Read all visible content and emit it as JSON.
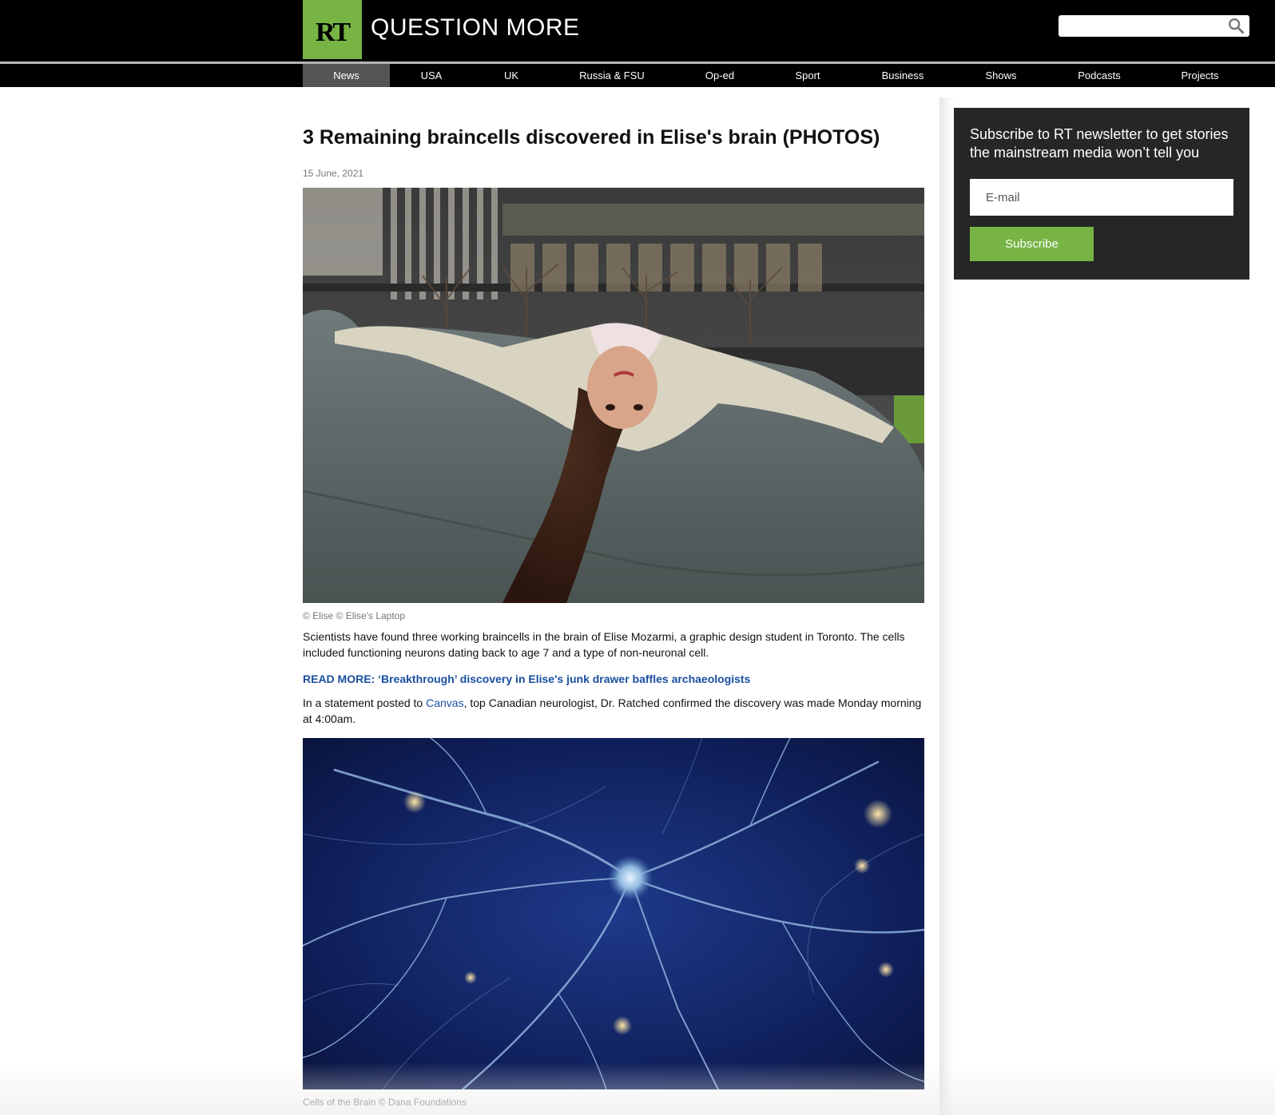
{
  "header": {
    "logo_text": "RT",
    "tagline": "QUESTION MORE",
    "search_placeholder": ""
  },
  "nav": {
    "items": [
      {
        "label": "News",
        "active": true
      },
      {
        "label": "USA"
      },
      {
        "label": "UK"
      },
      {
        "label": "Russia & FSU"
      },
      {
        "label": "Op-ed"
      },
      {
        "label": "Sport"
      },
      {
        "label": "Business"
      },
      {
        "label": "Shows"
      },
      {
        "label": "Podcasts"
      },
      {
        "label": "Projects"
      }
    ]
  },
  "article": {
    "title": "3 Remaining braincells discovered in Elise's brain (PHOTOS)",
    "date": "15 June, 2021",
    "image1_caption": "© Elise © Elise's Laptop",
    "paragraph1": "Scientists have found three working braincells in the brain of Elise Mozarmi, a graphic design student in Toronto. The cells included functioning neurons dating back to age 7 and a type of non-neuronal cell.",
    "read_more": "READ MORE: ‘Breakthrough’ discovery in Elise's junk drawer baffles archaeologists",
    "paragraph2_before": "In a statement posted to ",
    "paragraph2_link": "Canvas",
    "paragraph2_after": ", top Canadian neurologist, Dr. Ratched confirmed the discovery was made Monday morning at 4:00am.",
    "image2_caption": "Cells of the Brain © Dana Foundations"
  },
  "newsletter": {
    "text": "Subscribe to RT newsletter to get stories the mainstream media won’t tell you",
    "email_placeholder": "E-mail",
    "button_label": "Subscribe"
  },
  "colors": {
    "brand_green": "#77b443",
    "link_blue": "#1a4fa0",
    "header_bg": "#000000",
    "newsletter_bg": "#262626"
  }
}
